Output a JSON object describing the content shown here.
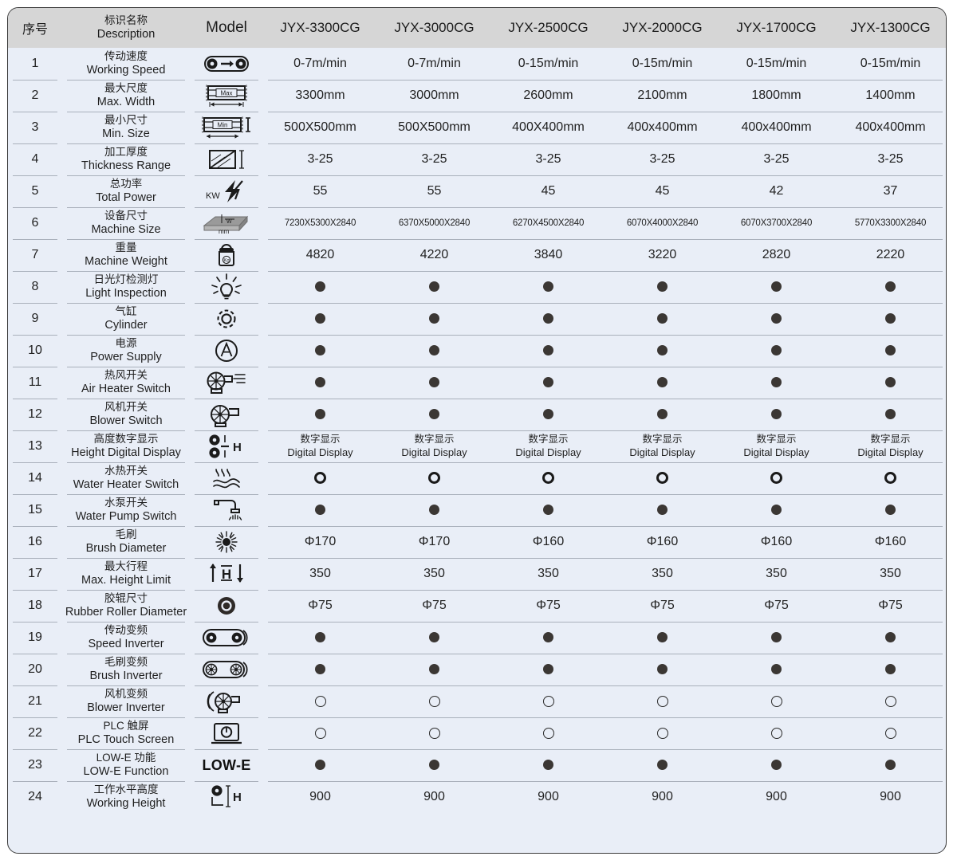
{
  "header": {
    "no": "序号",
    "description_cn": "标识名称",
    "description_en": "Description",
    "model": "Model",
    "columns": [
      "JYX-3300CG",
      "JYX-3000CG",
      "JYX-2500CG",
      "JYX-2000CG",
      "JYX-1700CG",
      "JYX-1300CG"
    ]
  },
  "colors": {
    "header_bg": "#d6d6d6",
    "row_bg": "#e9eef7",
    "frame_border": "#3a3a3a",
    "separator": "#a9b0bb",
    "marker_filled": "#3b3734",
    "marker_ring": "#1a1a1a"
  },
  "rows": [
    {
      "no": "1",
      "cn": "传动速度",
      "en": "Working Speed",
      "icon": "conveyor-speed-icon",
      "type": "text",
      "values": [
        "0-7m/min",
        "0-7m/min",
        "0-15m/min",
        "0-15m/min",
        "0-15m/min",
        "0-15m/min"
      ]
    },
    {
      "no": "2",
      "cn": "最大尺度",
      "en": "Max. Width",
      "icon": "max-width-icon",
      "type": "text",
      "values": [
        "3300mm",
        "3000mm",
        "2600mm",
        "2100mm",
        "1800mm",
        "1400mm"
      ]
    },
    {
      "no": "3",
      "cn": "最小尺寸",
      "en": "Min. Size",
      "icon": "min-size-icon",
      "type": "text",
      "values": [
        "500X500mm",
        "500X500mm",
        "400X400mm",
        "400x400mm",
        "400x400mm",
        "400x400mm"
      ]
    },
    {
      "no": "4",
      "cn": "加工厚度",
      "en": "Thickness Range",
      "icon": "thickness-icon",
      "type": "text",
      "values": [
        "3-25",
        "3-25",
        "3-25",
        "3-25",
        "3-25",
        "3-25"
      ]
    },
    {
      "no": "5",
      "cn": "总功率",
      "en": "Total Power",
      "icon": "power-kw-icon",
      "type": "text",
      "values": [
        "55",
        "55",
        "45",
        "45",
        "42",
        "37"
      ]
    },
    {
      "no": "6",
      "cn": "设备尺寸",
      "en": "Machine Size",
      "icon": "machine-size-icon",
      "type": "text-small",
      "values": [
        "7230X5300X2840",
        "6370X5000X2840",
        "6270X4500X2840",
        "6070X4000X2840",
        "6070X3700X2840",
        "5770X3300X2840"
      ]
    },
    {
      "no": "7",
      "cn": "重量",
      "en": "Machine Weight",
      "icon": "weight-kg-icon",
      "type": "text",
      "values": [
        "4820",
        "4220",
        "3840",
        "3220",
        "2820",
        "2220"
      ]
    },
    {
      "no": "8",
      "cn": "日光灯检测灯",
      "en": "Light Inspection",
      "icon": "lamp-icon",
      "type": "marker",
      "values": [
        "filled",
        "filled",
        "filled",
        "filled",
        "filled",
        "filled"
      ]
    },
    {
      "no": "9",
      "cn": "气缸",
      "en": "Cylinder",
      "icon": "gear-cylinder-icon",
      "type": "marker",
      "values": [
        "filled",
        "filled",
        "filled",
        "filled",
        "filled",
        "filled"
      ]
    },
    {
      "no": "10",
      "cn": "电源",
      "en": "Power Supply",
      "icon": "power-supply-a-icon",
      "type": "marker",
      "values": [
        "filled",
        "filled",
        "filled",
        "filled",
        "filled",
        "filled"
      ]
    },
    {
      "no": "11",
      "cn": "热风开关",
      "en": "Air Heater Switch",
      "icon": "air-heater-icon",
      "type": "marker",
      "values": [
        "filled",
        "filled",
        "filled",
        "filled",
        "filled",
        "filled"
      ]
    },
    {
      "no": "12",
      "cn": "风机开关",
      "en": "Blower Switch",
      "icon": "blower-icon",
      "type": "marker",
      "values": [
        "filled",
        "filled",
        "filled",
        "filled",
        "filled",
        "filled"
      ]
    },
    {
      "no": "13",
      "cn": "高度数字显示",
      "en": "Height Digital Display",
      "icon": "height-digital-icon",
      "type": "dual",
      "values_cn": [
        "数字显示",
        "数字显示",
        "数字显示",
        "数字显示",
        "数字显示",
        "数字显示"
      ],
      "values_en": [
        "Digital Display",
        "Digital Display",
        "Digital Display",
        "Digital Display",
        "Digital Display",
        "Digital Display"
      ]
    },
    {
      "no": "14",
      "cn": "水热开关",
      "en": "Water Heater Switch",
      "icon": "water-heater-icon",
      "type": "marker",
      "values": [
        "ring-bold",
        "ring-bold",
        "ring-bold",
        "ring-bold",
        "ring-bold",
        "ring-bold"
      ]
    },
    {
      "no": "15",
      "cn": "水泵开关",
      "en": "Water Pump Switch",
      "icon": "water-pump-icon",
      "type": "marker",
      "values": [
        "filled",
        "filled",
        "filled",
        "filled",
        "filled",
        "filled"
      ]
    },
    {
      "no": "16",
      "cn": "毛刷",
      "en": "Brush Diameter",
      "icon": "brush-icon",
      "type": "text",
      "values": [
        "Φ170",
        "Φ170",
        "Φ160",
        "Φ160",
        "Φ160",
        "Φ160"
      ]
    },
    {
      "no": "17",
      "cn": "最大行程",
      "en": "Max. Height Limit",
      "icon": "height-limit-icon",
      "type": "text",
      "values": [
        "350",
        "350",
        "350",
        "350",
        "350",
        "350"
      ]
    },
    {
      "no": "18",
      "cn": "胶辊尺寸",
      "en": "Rubber Roller Diameter",
      "icon": "rubber-roller-icon",
      "type": "text",
      "values": [
        "Φ75",
        "Φ75",
        "Φ75",
        "Φ75",
        "Φ75",
        "Φ75"
      ]
    },
    {
      "no": "19",
      "cn": "传动变频",
      "en": "Speed Inverter",
      "icon": "speed-inverter-icon",
      "type": "marker",
      "values": [
        "filled",
        "filled",
        "filled",
        "filled",
        "filled",
        "filled"
      ]
    },
    {
      "no": "20",
      "cn": "毛刷变频",
      "en": "Brush Inverter",
      "icon": "brush-inverter-icon",
      "type": "marker",
      "values": [
        "filled",
        "filled",
        "filled",
        "filled",
        "filled",
        "filled"
      ]
    },
    {
      "no": "21",
      "cn": "风机变频",
      "en": "Blower Inverter",
      "icon": "blower-inverter-icon",
      "type": "marker",
      "values": [
        "ring-thin",
        "ring-thin",
        "ring-thin",
        "ring-thin",
        "ring-thin",
        "ring-thin"
      ]
    },
    {
      "no": "22",
      "cn": "PLC 触屏",
      "en": "PLC Touch Screen",
      "icon": "plc-touch-screen-icon",
      "type": "marker",
      "values": [
        "ring-thin",
        "ring-thin",
        "ring-thin",
        "ring-thin",
        "ring-thin",
        "ring-thin"
      ]
    },
    {
      "no": "23",
      "cn": "LOW-E 功能",
      "en": "LOW-E Function",
      "icon": "low-e-icon",
      "icon_text": "LOW-E",
      "type": "marker",
      "values": [
        "filled",
        "filled",
        "filled",
        "filled",
        "filled",
        "filled"
      ]
    },
    {
      "no": "24",
      "cn": "工作水平高度",
      "en": "Working Height",
      "icon": "working-height-icon",
      "type": "text",
      "values": [
        "900",
        "900",
        "900",
        "900",
        "900",
        "900"
      ]
    }
  ]
}
